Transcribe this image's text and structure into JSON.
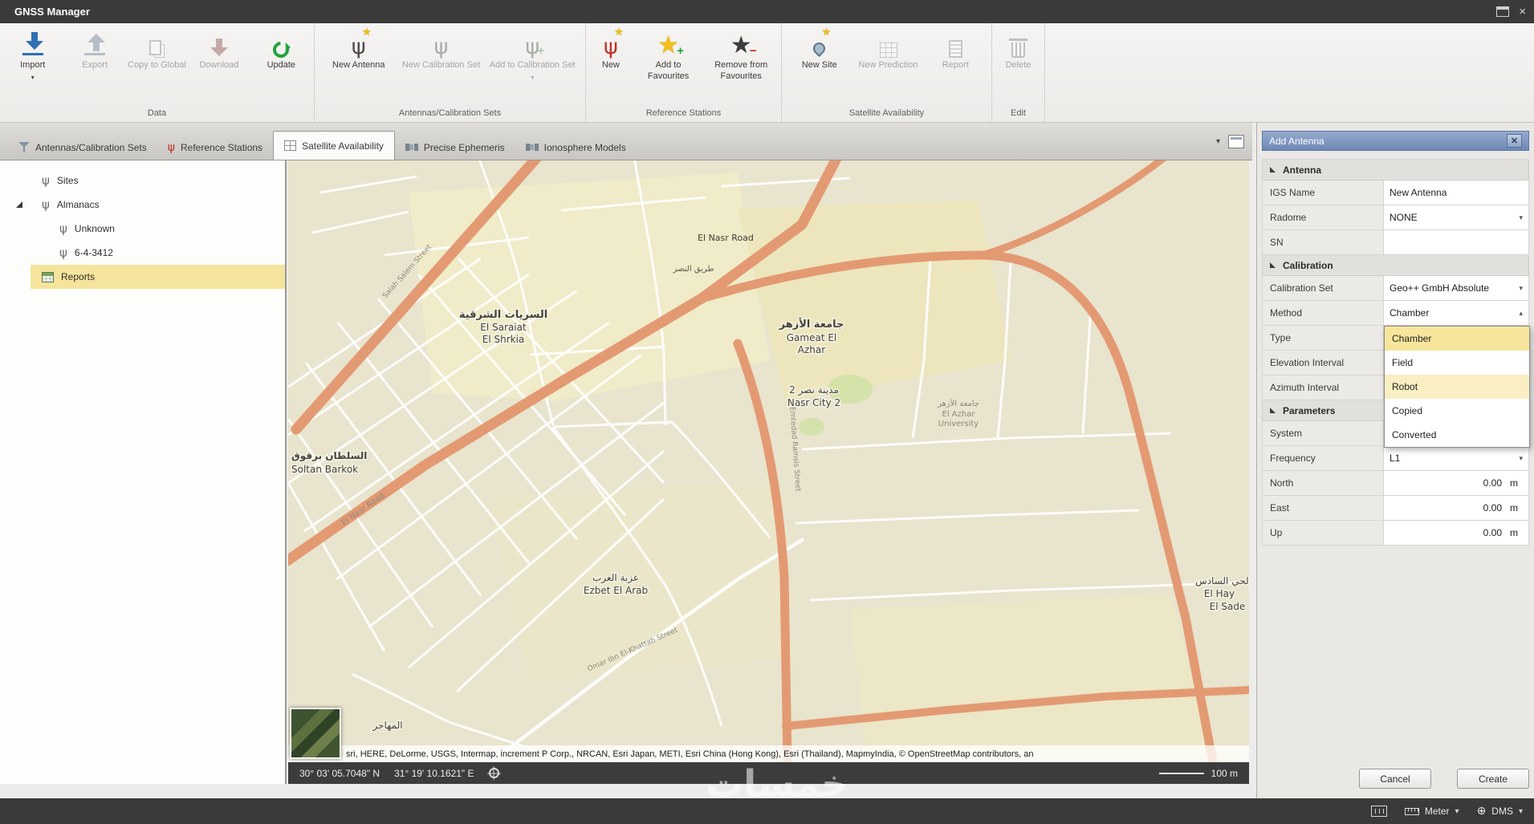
{
  "window": {
    "title": "GNSS Manager"
  },
  "ribbon": {
    "groups": [
      {
        "label": "Data",
        "buttons": [
          "Import",
          "Export",
          "Copy to Global",
          "Download",
          "Update"
        ]
      },
      {
        "label": "Antennas/Calibration Sets",
        "buttons": [
          "New Antenna",
          "New Calibration Set",
          "Add to Calibration Set"
        ]
      },
      {
        "label": "Reference Stations",
        "buttons": [
          "New",
          "Add to Favourites",
          "Remove from Favourites"
        ]
      },
      {
        "label": "Satellite Availability",
        "buttons": [
          "New Site",
          "New Prediction",
          "Report"
        ]
      },
      {
        "label": "Edit",
        "buttons": [
          "Delete"
        ]
      }
    ]
  },
  "tabs": {
    "items": [
      "Antennas/Calibration Sets",
      "Reference Stations",
      "Satellite Availability",
      "Precise Ephemeris",
      "Ionosphere Models"
    ],
    "active": "Satellite Availability"
  },
  "tree": {
    "sites": "Sites",
    "almanacs": "Almanacs",
    "unknown": "Unknown",
    "almanac_id": "6-4-3412",
    "reports": "Reports"
  },
  "map": {
    "places": {
      "saraiat_ar": "السريات الشرقية",
      "saraiat_en1": "El Saraiat",
      "saraiat_en2": "El Shrkia",
      "azhar_ar": "جامعة الأزهر",
      "azhar_en1": "Gameat El",
      "azhar_en2": "Azhar",
      "nasr2_ar": "مدينة نصر 2",
      "nasr2_en": "Nasr City 2",
      "soltan_ar": "السلطان برقوق",
      "soltan_en": "Soltan Barkok",
      "ezbet_ar": "عزبة العرب",
      "ezbet_en": "Ezbet El Arab",
      "hay_ar": "الحي السادس",
      "hay_en1": "El Hay",
      "hay_en2": "El Sade",
      "mohager_ar": "المهاجر",
      "univ_en1": "El Azhar",
      "univ_en2": "University"
    },
    "streets": {
      "nasr_en": "El Nasr Road",
      "nasr_ar": "طريق النصر",
      "salah": "Salah Salem Street",
      "ramsis": "Emtedad Ramsis Street",
      "omar": "Omar Ibn El-Khattab Street"
    },
    "attribution": "sri, HERE, DeLorme, USGS, Intermap, increment P Corp., NRCAN, Esri Japan, METI, Esri China (Hong Kong), Esri (Thailand), MapmyIndia, © OpenStreetMap contributors, an",
    "status": {
      "lat": "30° 03' 05.7048\" N",
      "lon": "31° 19' 10.1621\" E",
      "scale": "100 m"
    }
  },
  "panel": {
    "title": "Add Antenna",
    "antenna_section": "Antenna",
    "calibration_section": "Calibration",
    "parameters_section": "Parameters",
    "rows": {
      "igs_label": "IGS Name",
      "igs_value": "New Antenna",
      "radome_label": "Radome",
      "radome_value": "NONE",
      "sn_label": "SN",
      "sn_value": "",
      "calset_label": "Calibration Set",
      "calset_value": "Geo++ GmbH Absolute",
      "method_label": "Method",
      "method_value": "Chamber",
      "type_label": "Type",
      "elev_label": "Elevation Interval",
      "azim_label": "Azimuth Interval",
      "system_label": "System",
      "freq_label": "Frequency",
      "freq_value": "L1",
      "north_label": "North",
      "north_value": "0.00",
      "east_label": "East",
      "east_value": "0.00",
      "up_label": "Up",
      "up_value": "0.00",
      "unit": "m"
    },
    "method_options": [
      "Chamber",
      "Field",
      "Robot",
      "Copied",
      "Converted"
    ],
    "cancel": "Cancel",
    "create": "Create"
  },
  "statusbar": {
    "meter": "Meter",
    "dms": "DMS"
  },
  "watermark": "خمسات"
}
